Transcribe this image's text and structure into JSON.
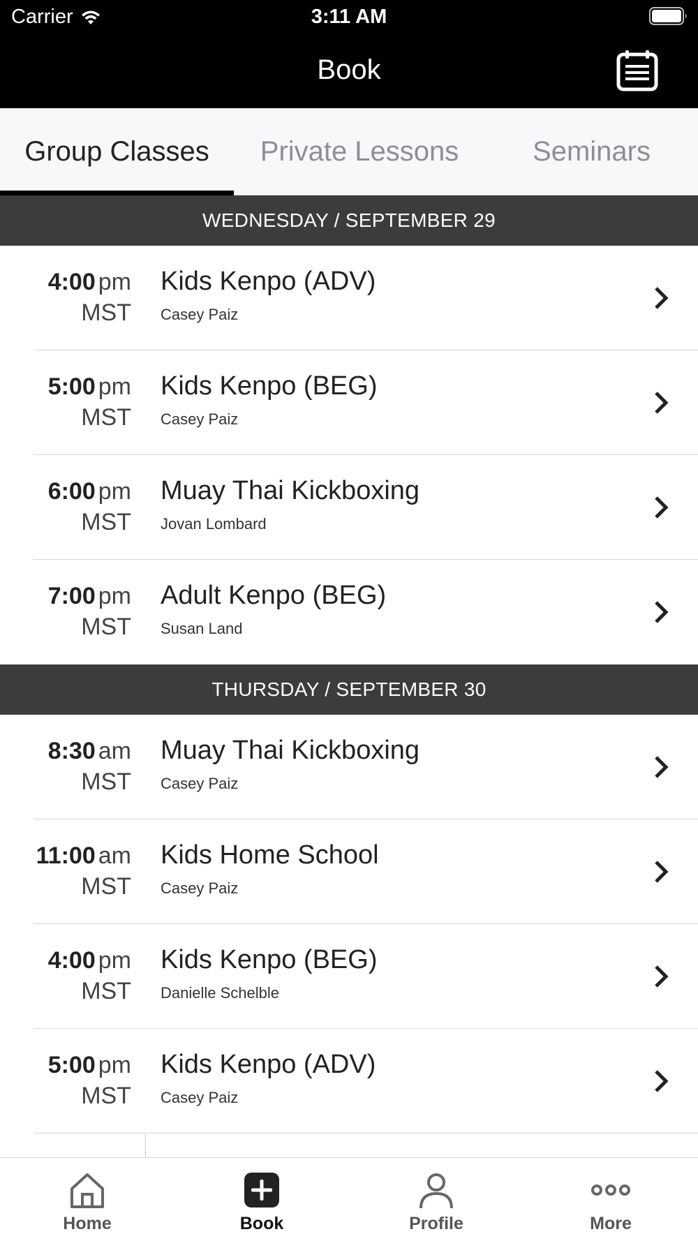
{
  "status_bar": {
    "carrier": "Carrier",
    "time": "3:11 AM"
  },
  "header": {
    "title": "Book",
    "calendar_icon": "calendar-list-icon"
  },
  "tabs": [
    {
      "label": "Group Classes",
      "active": true
    },
    {
      "label": "Private Lessons",
      "active": false
    },
    {
      "label": "Seminars",
      "active": false
    }
  ],
  "days": [
    {
      "header": "WEDNESDAY / SEPTEMBER 29",
      "classes": [
        {
          "time": "4:00",
          "ampm": "pm",
          "tz": "MST",
          "name": "Kids Kenpo (ADV)",
          "instructor": "Casey Paiz"
        },
        {
          "time": "5:00",
          "ampm": "pm",
          "tz": "MST",
          "name": "Kids Kenpo (BEG)",
          "instructor": "Casey Paiz"
        },
        {
          "time": "6:00",
          "ampm": "pm",
          "tz": "MST",
          "name": "Muay Thai Kickboxing",
          "instructor": "Jovan Lombard"
        },
        {
          "time": "7:00",
          "ampm": "pm",
          "tz": "MST",
          "name": "Adult Kenpo (BEG)",
          "instructor": "Susan Land"
        }
      ]
    },
    {
      "header": "THURSDAY / SEPTEMBER 30",
      "classes": [
        {
          "time": "8:30",
          "ampm": "am",
          "tz": "MST",
          "name": "Muay Thai Kickboxing",
          "instructor": "Casey Paiz"
        },
        {
          "time": "11:00",
          "ampm": "am",
          "tz": "MST",
          "name": "Kids Home School",
          "instructor": "Casey Paiz"
        },
        {
          "time": "4:00",
          "ampm": "pm",
          "tz": "MST",
          "name": "Kids Kenpo (BEG)",
          "instructor": "Danielle Schelble"
        },
        {
          "time": "5:00",
          "ampm": "pm",
          "tz": "MST",
          "name": "Kids Kenpo (ADV)",
          "instructor": "Casey Paiz"
        }
      ]
    }
  ],
  "bottom_nav": [
    {
      "label": "Home",
      "icon": "home-icon",
      "active": false
    },
    {
      "label": "Book",
      "icon": "plus-square-icon",
      "active": true
    },
    {
      "label": "Profile",
      "icon": "person-icon",
      "active": false
    },
    {
      "label": "More",
      "icon": "more-dots-icon",
      "active": false
    }
  ]
}
